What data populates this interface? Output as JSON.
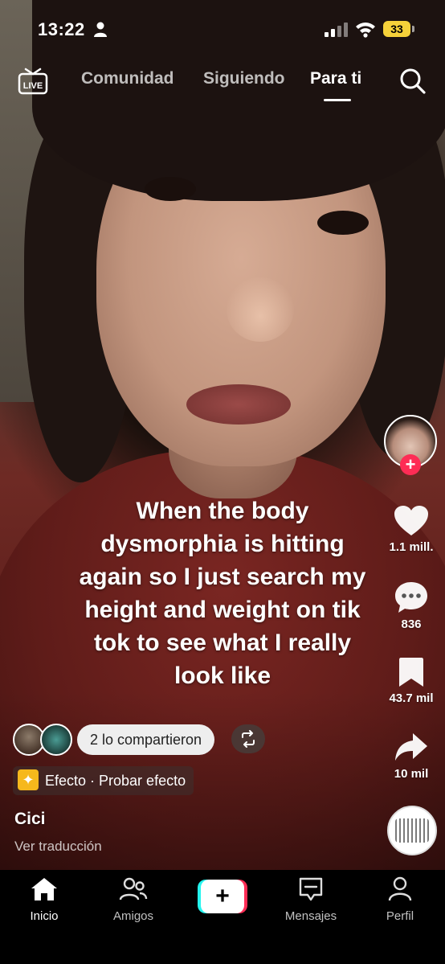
{
  "status_bar": {
    "time": "13:22",
    "battery": "33",
    "battery_color": "#f5d13a"
  },
  "top_nav": {
    "tabs": [
      {
        "label": "Comunidad"
      },
      {
        "label": "Siguiendo"
      },
      {
        "label": "Para ti",
        "active": true
      }
    ],
    "live_icon": "live-icon",
    "search_icon": "search-icon"
  },
  "video": {
    "caption": "When the body dysmorphia is hitting again so I just search my height and weight on tik tok to see what I really look like",
    "author": "Cici",
    "translate_label": "Ver traducción",
    "shared_label": "2 lo compartieron",
    "effect_label": "Efecto · Probar efecto"
  },
  "actions": {
    "likes": "1.1 mill.",
    "comments": "836",
    "saves": "43.7 mil",
    "shares": "10 mil",
    "follow_color": "#fe2c55"
  },
  "bottom_nav": {
    "items": [
      {
        "label": "Inicio",
        "icon": "home-icon",
        "active": true
      },
      {
        "label": "Amigos",
        "icon": "friends-icon"
      },
      {
        "label": "Mensajes",
        "icon": "inbox-icon"
      },
      {
        "label": "Perfil",
        "icon": "profile-icon"
      }
    ],
    "create_label": "+"
  }
}
